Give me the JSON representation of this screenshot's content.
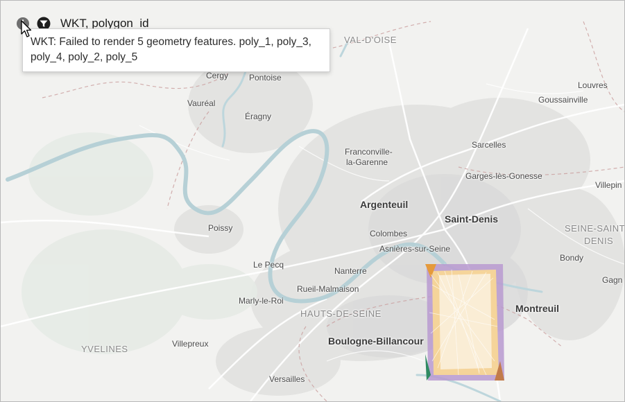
{
  "header": {
    "title": "WKT, polygon_id",
    "info_icon": "info-icon",
    "filter_icon": "filter-icon"
  },
  "tooltip": {
    "text": "WKT: Failed to render 5 geometry features. poly_1, poly_3, poly_4, poly_2, poly_5"
  },
  "map": {
    "places": {
      "val_doise": "VAL-D'OISE",
      "cergy": "Cergy",
      "pontoise": "Pontoise",
      "vaureal": "Vauréal",
      "eragny": "Éragny",
      "louvres": "Louvres",
      "goussainville": "Goussainville",
      "franconville_1": "Franconville-",
      "franconville_2": "la-Garenne",
      "sarcelles": "Sarcelles",
      "garges": "Garges-lès-Gonesse",
      "villepinte": "Villepin",
      "argenteuil": "Argenteuil",
      "saint_denis": "Saint-Denis",
      "seine_st_1": "SEINE-SAINT",
      "seine_st_2": "DENIS",
      "poissy": "Poissy",
      "colombes": "Colombes",
      "asnieres": "Asnières-sur-Seine",
      "bondy": "Bondy",
      "le_pecq": "Le Pecq",
      "nanterre": "Nanterre",
      "gagny": "Gagn",
      "rueil": "Rueil-Malmaison",
      "marly": "Marly-le-Roi",
      "hauts_de_seine": "HAUTS-DE-SEINE",
      "montreuil": "Montreuil",
      "boulogne": "Boulogne-Billancour",
      "yvelines": "YVELINES",
      "villepreux": "Villepreux",
      "versailles": "Versailles"
    }
  }
}
